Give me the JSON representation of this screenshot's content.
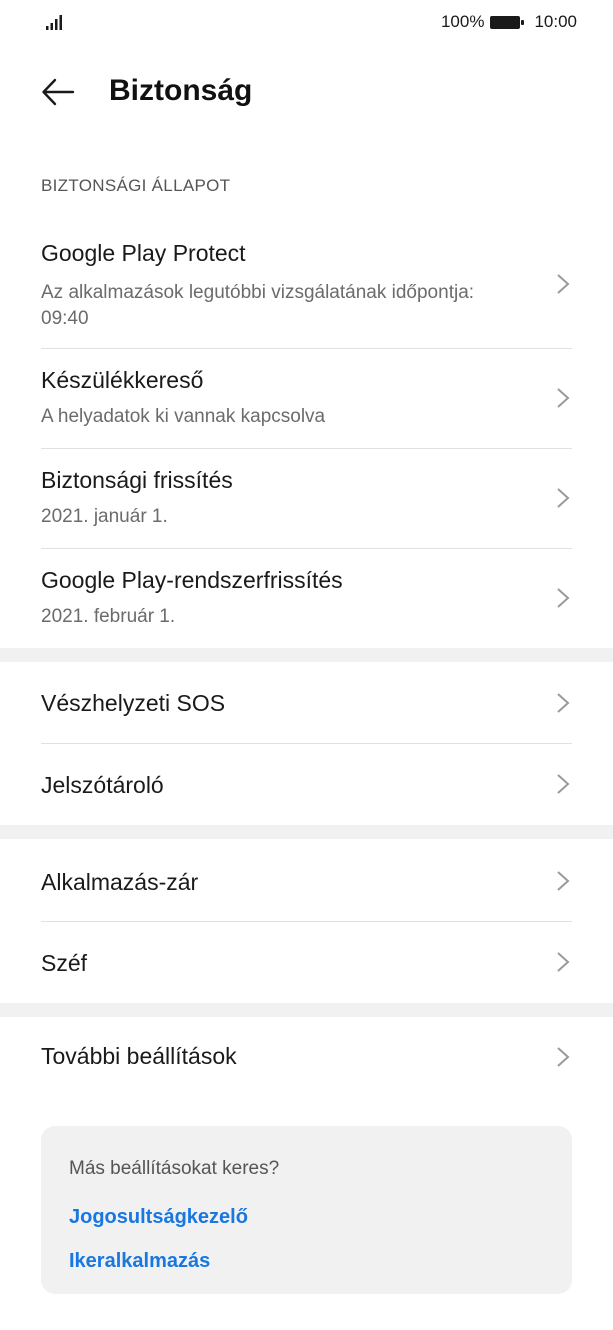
{
  "status_bar": {
    "battery_percent": "100%",
    "time": "10:00",
    "icons": [
      "signal-icon",
      "battery-icon"
    ]
  },
  "header": {
    "title": "Biztonság",
    "back_icon": "arrow-left-icon"
  },
  "section": {
    "label": "BIZTONSÁGI ÁLLAPOT"
  },
  "status_items": [
    {
      "title": "Google Play Protect",
      "subtitle": "Az alkalmazások legutóbbi vizsgálatának időpontja: 09:40"
    },
    {
      "title": "Készülékkereső",
      "subtitle": "A helyadatok ki vannak kapcsolva"
    },
    {
      "title": "Biztonsági frissítés",
      "subtitle": "2021. január 1."
    },
    {
      "title": "Google Play-rendszerfrissítés",
      "subtitle": "2021. február 1."
    }
  ],
  "group2": [
    {
      "title": "Vészhelyzeti SOS"
    },
    {
      "title": "Jelszótároló"
    }
  ],
  "group3": [
    {
      "title": "Alkalmazás-zár"
    },
    {
      "title": "Széf"
    }
  ],
  "group4": [
    {
      "title": "További beállítások"
    }
  ],
  "suggestion_card": {
    "hint": "Más beállításokat keres?",
    "links": [
      "Jogosultságkezelő",
      "Ikeralkalmazás"
    ]
  },
  "colors": {
    "link": "#1877e0",
    "divider": "#e1e1e1",
    "gap_background": "#f1f1f1"
  }
}
